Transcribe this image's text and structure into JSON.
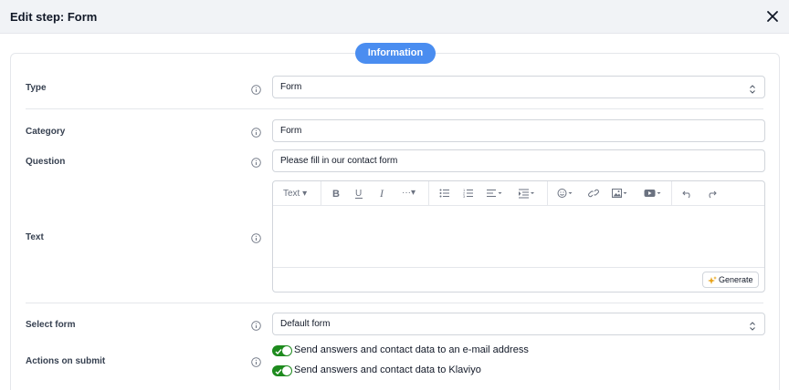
{
  "header": {
    "title": "Edit step: Form"
  },
  "tabs": {
    "information": "Information"
  },
  "fields": {
    "type": {
      "label": "Type",
      "value": "Form"
    },
    "category": {
      "label": "Category",
      "value": "Form"
    },
    "question": {
      "label": "Question",
      "value": "Please fill in our contact form"
    },
    "text": {
      "label": "Text"
    },
    "select_form": {
      "label": "Select form",
      "value": "Default form"
    },
    "actions": {
      "label": "Actions on submit"
    }
  },
  "editor": {
    "text_style": "Text",
    "generate_label": "Generate"
  },
  "actions_on_submit": [
    {
      "label": "Send answers and contact data to an e-mail address",
      "enabled": true
    },
    {
      "label": "Send answers and contact data to Klaviyo",
      "enabled": true
    }
  ],
  "colors": {
    "accent": "#4a8df0",
    "toggle_on": "#1d8a1d"
  }
}
